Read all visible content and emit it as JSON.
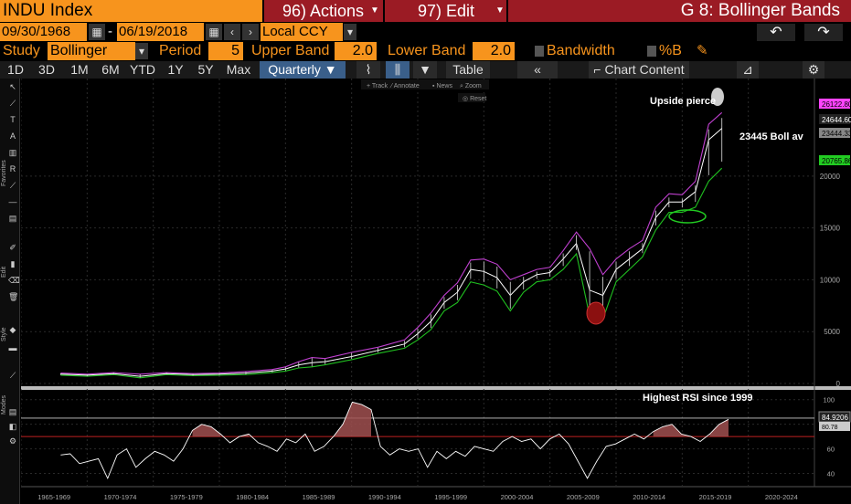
{
  "header": {
    "ticker": "INDU Index",
    "actions_label": "96) Actions",
    "edit_label": "97) Edit",
    "chart_title": "G 8: Bollinger Bands"
  },
  "range": {
    "start_date": "09/30/1968",
    "separator": "-",
    "end_date": "06/19/2018",
    "currency": "Local CCY"
  },
  "study": {
    "study_label": "Study",
    "study_value": "Bollinger",
    "period_label": "Period",
    "period_value": "5",
    "upper_label": "Upper Band",
    "upper_value": "2.0",
    "lower_label": "Lower Band",
    "lower_value": "2.0",
    "bandwidth_label": "Bandwidth",
    "pctb_label": "%B"
  },
  "periods": [
    "1D",
    "3D",
    "1M",
    "6M",
    "YTD",
    "1Y",
    "5Y",
    "Max"
  ],
  "frequency": "Quarterly",
  "toolbar": {
    "table_label": "Table",
    "chart_content_label": "Chart Content",
    "track": "Track",
    "annotate": "Annotate",
    "news": "News",
    "zoom": "Zoom",
    "reset": "Reset"
  },
  "sidebar_labels": {
    "favorites": "Favorites",
    "edit": "Edit",
    "style": "Style",
    "modes": "Modes"
  },
  "colors": {
    "accent_orange": "#f7941d",
    "header_red": "#9b1b24",
    "upper_band": "#c040d0",
    "lower_band": "#20c020",
    "price": "#ffffff",
    "rsi_fill": "#a05050",
    "rsi_line_70": "#c02020",
    "current_price_tag": "#ff44ff",
    "lower_tag": "#22cc22"
  },
  "chart_data": {
    "type": "line",
    "title": "",
    "x": [
      1968,
      1970,
      1972,
      1974,
      1976,
      1978,
      1980,
      1982,
      1984,
      1985,
      1986,
      1987,
      1988,
      1990,
      1992,
      1994,
      1995,
      1996,
      1997,
      1998,
      1999,
      2000,
      2001,
      2002,
      2003,
      2004,
      2005,
      2006,
      2007,
      2008,
      2009,
      2010,
      2011,
      2012,
      2013,
      2014,
      2015,
      2016,
      2017,
      2018
    ],
    "x_tick_labels": [
      "1965-1969",
      "1970-1974",
      "1975-1979",
      "1980-1984",
      "1985-1989",
      "1990-1994",
      "1995-1999",
      "2000-2004",
      "2005-2009",
      "2010-2014",
      "2015-2019",
      "2020-2024"
    ],
    "y_ticks": [
      0,
      5000,
      10000,
      15000,
      20000
    ],
    "ylim": [
      0,
      28000
    ],
    "series": [
      {
        "values": [
          900,
          800,
          950,
          700,
          950,
          850,
          900,
          1000,
          1200,
          1400,
          1800,
          2000,
          2100,
          2600,
          3200,
          3800,
          4800,
          6000,
          7800,
          8800,
          11000,
          10800,
          10200,
          8500,
          9800,
          10500,
          10700,
          12000,
          13500,
          9000,
          8500,
          11000,
          12000,
          13000,
          16000,
          17500,
          17500,
          18500,
          23500,
          24600
        ]
      },
      {
        "values": [
          1000,
          900,
          1050,
          900,
          1050,
          950,
          1000,
          1150,
          1350,
          1600,
          2100,
          2500,
          2400,
          3000,
          3500,
          4200,
          5400,
          6800,
          8500,
          9700,
          11900,
          12000,
          11500,
          10000,
          10500,
          11000,
          11200,
          12800,
          14600,
          13000,
          10500,
          12000,
          13000,
          13800,
          17000,
          18300,
          18200,
          19500,
          25000,
          26123
        ]
      },
      {
        "values": [
          800,
          700,
          850,
          550,
          850,
          750,
          800,
          850,
          1050,
          1200,
          1500,
          1600,
          1800,
          2300,
          2900,
          3400,
          4200,
          5200,
          7000,
          7800,
          9800,
          9500,
          8900,
          7000,
          8800,
          9800,
          10000,
          11000,
          12500,
          6500,
          6200,
          9800,
          11000,
          12200,
          14800,
          16500,
          16500,
          17000,
          19500,
          20766
        ]
      }
    ],
    "current_tags": [
      "26122.80",
      "24644.60",
      "23444.33",
      "20765.86"
    ],
    "annotations": [
      "Upside pierce",
      "23445 Boll av",
      "Highest RSI since 1999"
    ],
    "rsi": {
      "y_ticks": [
        40,
        60,
        80,
        100
      ],
      "ylim": [
        30,
        105
      ],
      "overbought": 70,
      "current_tag": "84.9206",
      "secondary_tag": "80.78",
      "values": [
        55,
        56,
        48,
        50,
        52,
        36,
        55,
        60,
        45,
        52,
        58,
        55,
        50,
        60,
        75,
        80,
        78,
        72,
        65,
        70,
        72,
        65,
        62,
        58,
        68,
        65,
        72,
        58,
        62,
        70,
        80,
        98,
        96,
        92,
        62,
        55,
        60,
        58,
        60,
        45,
        58,
        52,
        58,
        54,
        62,
        60,
        58,
        66,
        70,
        66,
        68,
        60,
        68,
        72,
        64,
        50,
        36,
        50,
        62,
        64,
        68,
        72,
        68,
        74,
        78,
        80,
        72,
        70,
        66,
        72,
        80,
        84
      ]
    }
  }
}
